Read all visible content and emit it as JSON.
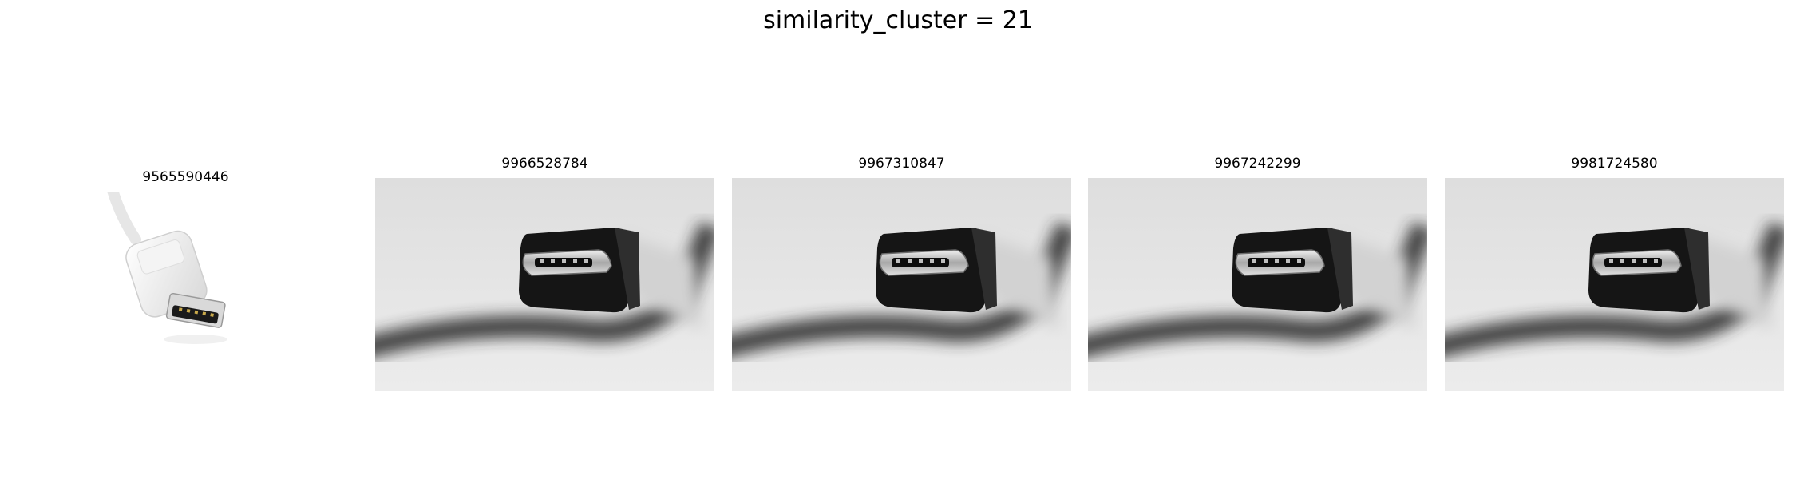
{
  "figure": {
    "title": "similarity_cluster = 21"
  },
  "panels": [
    {
      "label": "9565590446",
      "image": "white-micro-usb-plug-photo"
    },
    {
      "label": "9966528784",
      "image": "black-micro-usb-plug-closeup-photo"
    },
    {
      "label": "9967310847",
      "image": "black-micro-usb-plug-closeup-photo"
    },
    {
      "label": "9967242299",
      "image": "black-micro-usb-plug-closeup-photo"
    },
    {
      "label": "9981724580",
      "image": "black-micro-usb-plug-closeup-photo"
    }
  ]
}
